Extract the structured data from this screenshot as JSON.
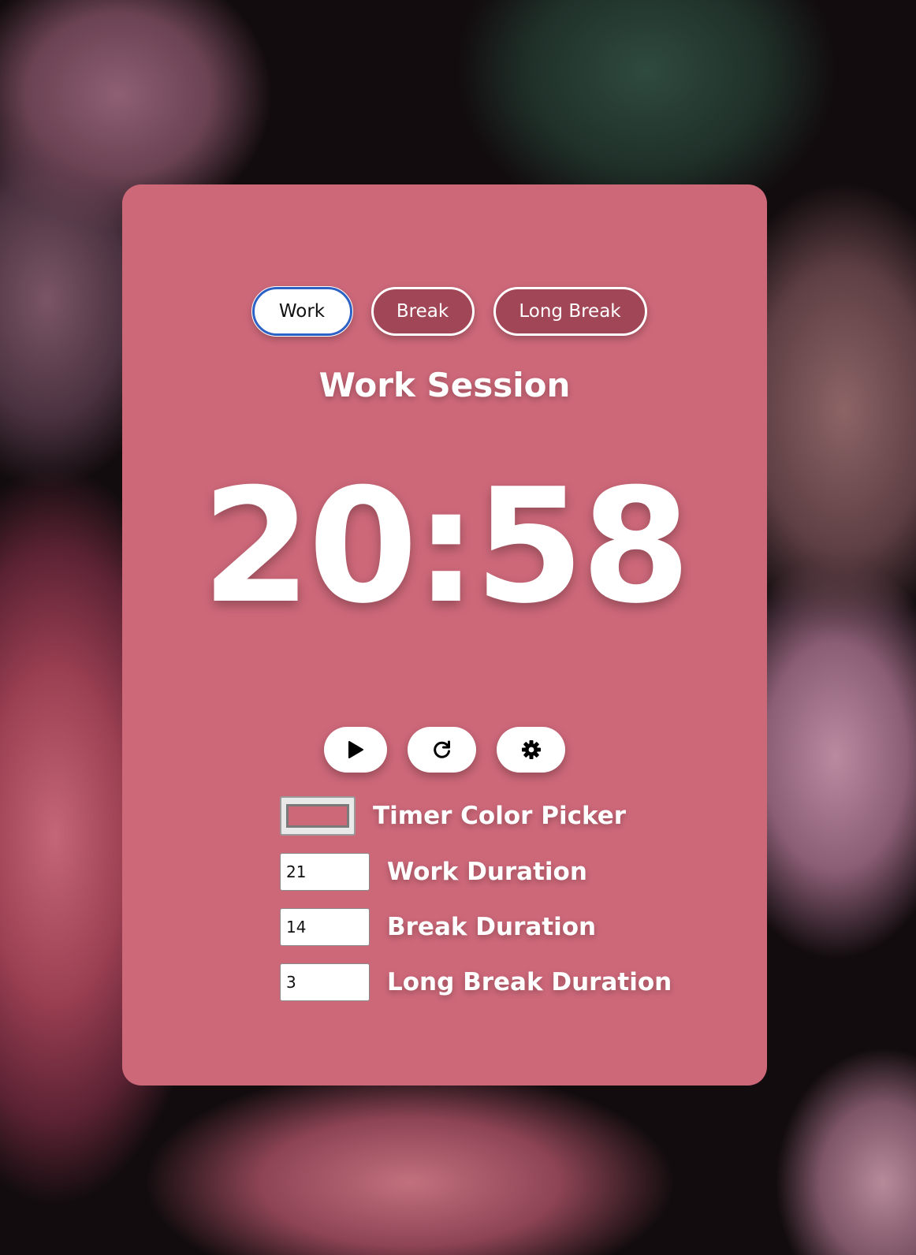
{
  "tabs": [
    {
      "label": "Work",
      "active": true
    },
    {
      "label": "Break",
      "active": false
    },
    {
      "label": "Long Break",
      "active": false
    }
  ],
  "session_title": "Work Session",
  "timer_display": "20:58",
  "controls": {
    "play_icon": "play-icon",
    "reset_icon": "reset-icon",
    "settings_icon": "gear-icon"
  },
  "settings": {
    "color_picker_label": "Timer Color Picker",
    "color_value": "#cd6879",
    "work_duration_label": "Work Duration",
    "work_duration_value": "21",
    "break_duration_label": "Break Duration",
    "break_duration_value": "14",
    "long_break_duration_label": "Long Break Duration",
    "long_break_duration_value": "3"
  },
  "colors": {
    "card_background": "#cd6879",
    "tab_inactive": "#a14656",
    "tab_focus_ring": "#2c61c5"
  }
}
